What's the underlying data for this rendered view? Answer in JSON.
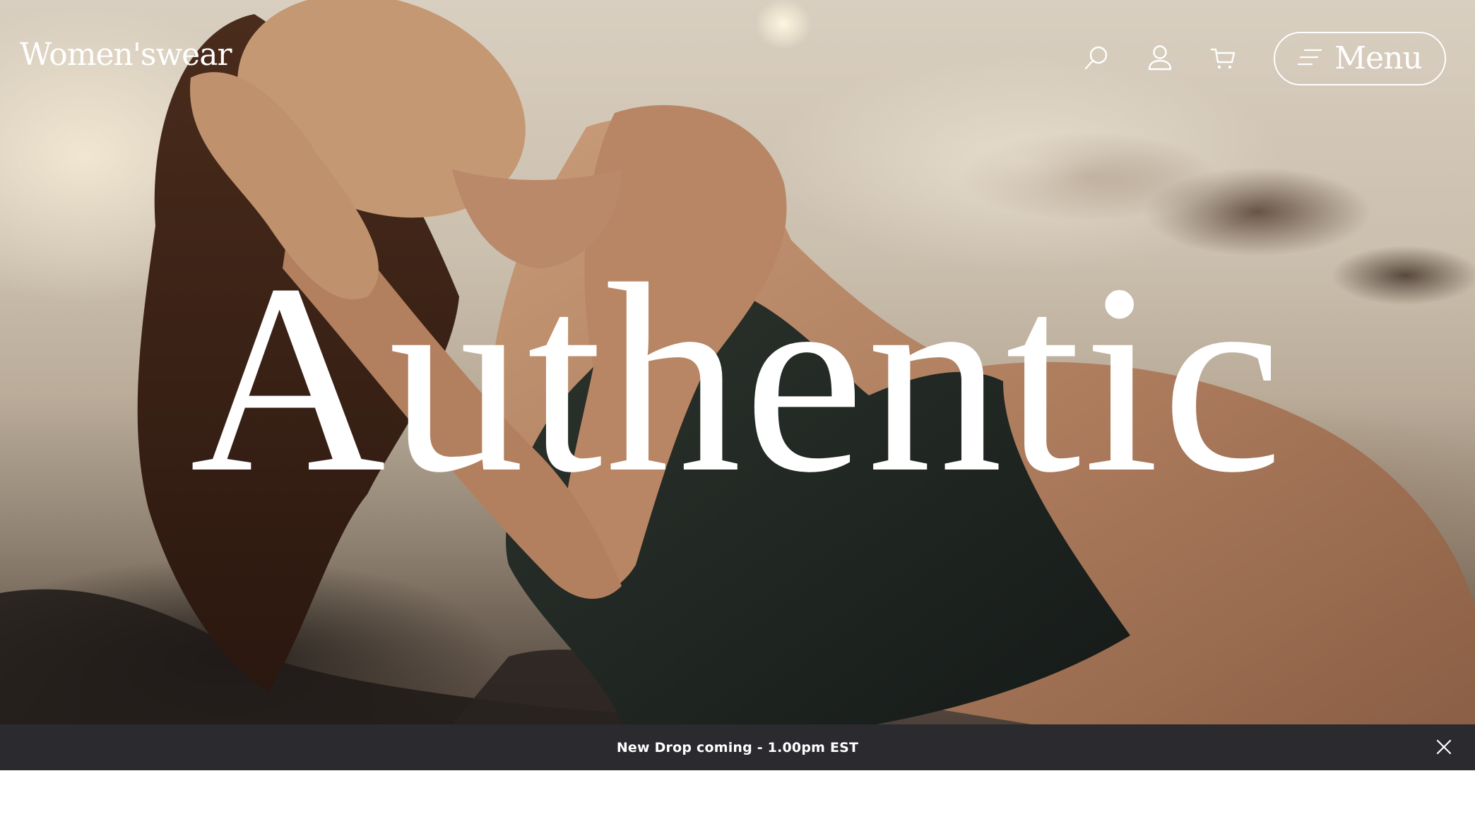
{
  "brand": {
    "logo_text": "Women'swear"
  },
  "header": {
    "icons": [
      "search-icon",
      "account-icon",
      "cart-icon"
    ],
    "menu_label": "Menu",
    "menu_icon": "menu-lines-icon"
  },
  "hero": {
    "headline": "Authentic",
    "image_description_colors": {
      "swimsuit": "#1f2420",
      "skin": "#b98a66",
      "hair": "#3a2317"
    }
  },
  "announcement": {
    "text": "New Drop coming - 1.00pm EST",
    "close_icon": "close-icon",
    "background": "#2a2a2f"
  }
}
